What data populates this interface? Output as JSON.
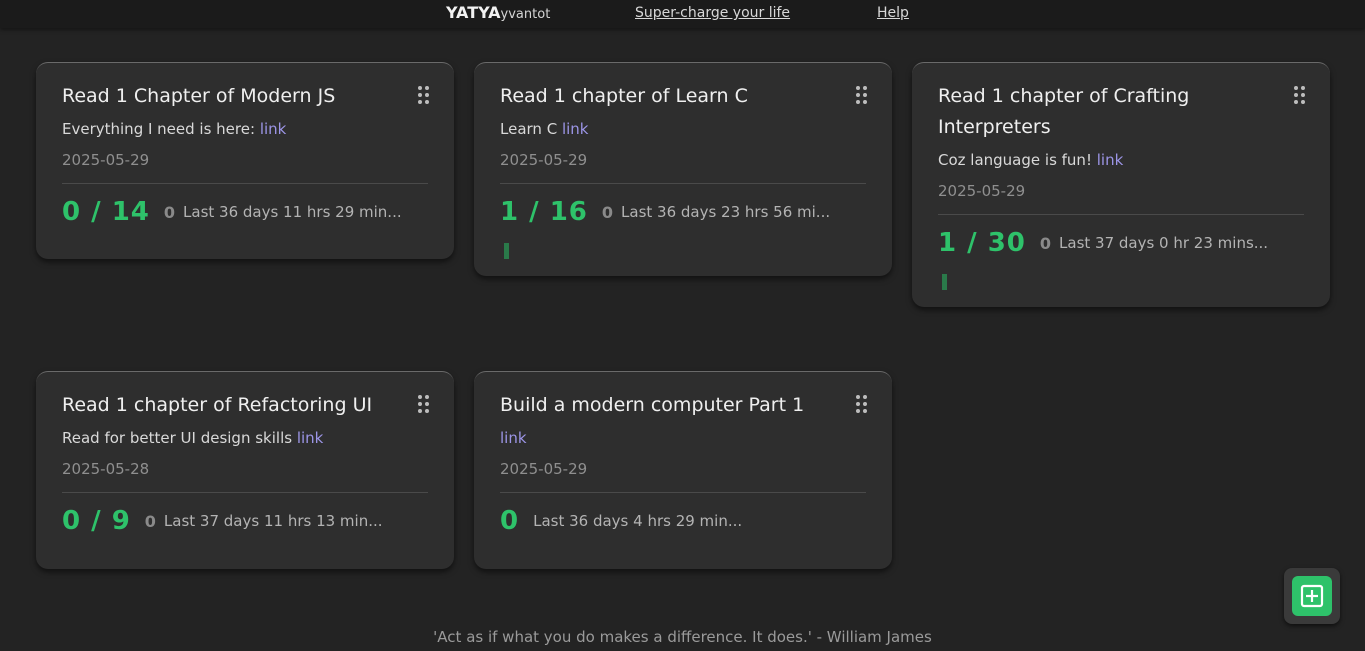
{
  "header": {
    "brand_main": "YATYA",
    "brand_sub": "yvantot",
    "nav": [
      {
        "label": "Super-charge your life"
      },
      {
        "label": "Help"
      }
    ]
  },
  "cards": [
    {
      "title": "Read 1 Chapter of Modern JS",
      "desc_text": "Everything I need is here:",
      "link_label": "link",
      "date": "2025-05-29",
      "count": "0 / 14",
      "streak": "0",
      "last": "Last 36 days 11 hrs 29 min..."
    },
    {
      "title": "Read 1 chapter of Learn C",
      "desc_text": "Learn C",
      "link_label": "link",
      "date": "2025-05-29",
      "count": "1 / 16",
      "streak": "0",
      "last": "Last 36 days 23 hrs 56 mi..."
    },
    {
      "title": "Read 1 chapter of Crafting Interpreters",
      "desc_text": "Coz language is fun!",
      "link_label": "link",
      "date": "2025-05-29",
      "count": "1 / 30",
      "streak": "0",
      "last": "Last 37 days 0 hr 23 mins..."
    },
    {
      "title": "Read 1 chapter of Refactoring UI",
      "desc_text": "Read for better UI design skills",
      "link_label": "link",
      "date": "2025-05-28",
      "count": "0 / 9",
      "streak": "0",
      "last": "Last 37 days 11 hrs 13 min..."
    },
    {
      "title": "Build a modern computer Part 1",
      "desc_text": "",
      "link_label": "link",
      "date": "2025-05-29",
      "count": "0",
      "streak": "",
      "last": "Last 36 days 4 hrs 29 min..."
    }
  ],
  "add_button": {
    "icon": "plus-square-icon",
    "color": "#2ec26a"
  },
  "footer": {
    "quote": "'Act as if what you do makes a difference. It does.' - William James"
  },
  "colors": {
    "accent_green": "#2ec26a",
    "link": "#9c95e6",
    "background": "#232323",
    "card": "#2e2e2e"
  }
}
